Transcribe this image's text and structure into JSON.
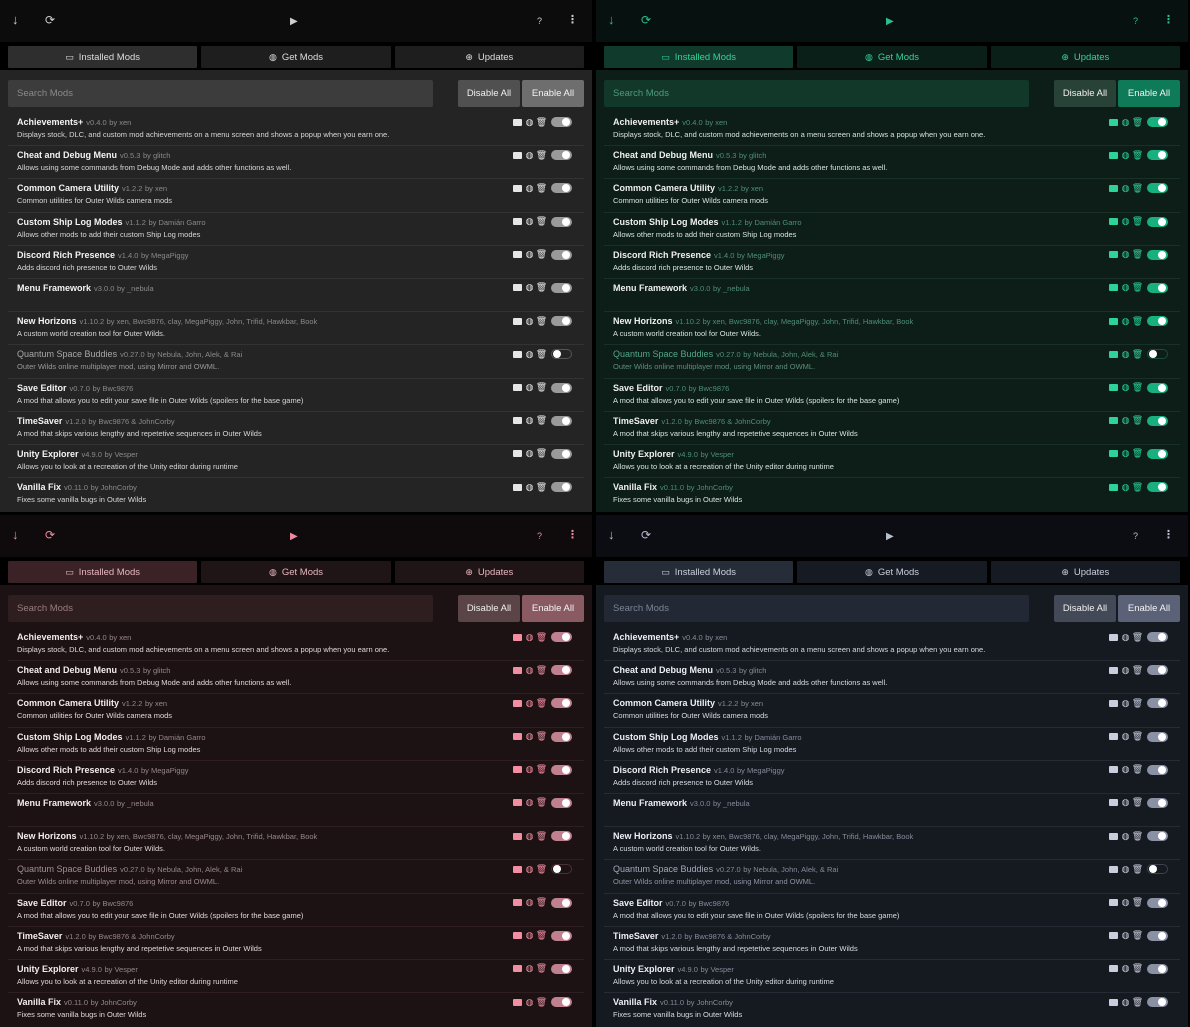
{
  "topbar": {
    "download_icon": "↓",
    "refresh_icon": "⟳",
    "play_icon": "▶",
    "help_icon": "?",
    "more_icon": "⋮"
  },
  "tabs": [
    {
      "label": "Installed Mods",
      "icon": "monitor-icon"
    },
    {
      "label": "Get Mods",
      "icon": "globe-icon"
    },
    {
      "label": "Updates",
      "icon": "arrow-up-circle-icon"
    }
  ],
  "search": {
    "placeholder": "Search Mods"
  },
  "buttons": {
    "disable_all": "Disable All",
    "enable_all": "Enable All"
  },
  "themes": [
    {
      "name": "grey",
      "accent": "#9a9a9a"
    },
    {
      "name": "green",
      "accent": "#17b07e"
    },
    {
      "name": "pink",
      "accent": "#c0808e"
    },
    {
      "name": "slate",
      "accent": "#8a91a5"
    }
  ],
  "mods": [
    {
      "name": "Achievements+",
      "version": "v0.4.0",
      "authors": "by xen",
      "description": "Displays stock, DLC, and custom mod achievements on a menu screen and shows a popup when you earn one.",
      "enabled": true
    },
    {
      "name": "Cheat and Debug Menu",
      "version": "v0.5.3",
      "authors": "by glitch",
      "description": "Allows using some commands from Debug Mode and adds other functions as well.",
      "enabled": true
    },
    {
      "name": "Common Camera Utility",
      "version": "v1.2.2",
      "authors": "by xen",
      "description": "Common utilities for Outer Wilds camera mods",
      "enabled": true
    },
    {
      "name": "Custom Ship Log Modes",
      "version": "v1.1.2",
      "authors": "by Damián Garro",
      "description": "Allows other mods to add their custom Ship Log modes",
      "enabled": true
    },
    {
      "name": "Discord Rich Presence",
      "version": "v1.4.0",
      "authors": "by MegaPiggy",
      "description": "Adds discord rich presence to Outer Wilds",
      "enabled": true
    },
    {
      "name": "Menu Framework",
      "version": "v3.0.0",
      "authors": "by _nebula",
      "description": "",
      "enabled": true
    },
    {
      "name": "New Horizons",
      "version": "v1.10.2",
      "authors": "by xen, Bwc9876, clay, MegaPiggy, John, Trifid, Hawkbar, Book",
      "description": "A custom world creation tool for Outer Wilds.",
      "enabled": true
    },
    {
      "name": "Quantum Space Buddies",
      "version": "v0.27.0",
      "authors": "by Nebula, John, Alek, & Rai",
      "description": "Outer Wilds online multiplayer mod, using Mirror and OWML.",
      "enabled": false
    },
    {
      "name": "Save Editor",
      "version": "v0.7.0",
      "authors": "by Bwc9876",
      "description": "A mod that allows you to edit your save file in Outer Wilds (spoilers for the base game)",
      "enabled": true
    },
    {
      "name": "TimeSaver",
      "version": "v1.2.0",
      "authors": "by Bwc9876 & JohnCorby",
      "description": "A mod that skips various lengthy and repetetive sequences in Outer Wilds",
      "enabled": true
    },
    {
      "name": "Unity Explorer",
      "version": "v4.9.0",
      "authors": "by Vesper",
      "description": "Allows you to look at a recreation of the Unity editor during runtime",
      "enabled": true
    },
    {
      "name": "Vanilla Fix",
      "version": "v0.11.0",
      "authors": "by JohnCorby",
      "description": "Fixes some vanilla bugs in Outer Wilds",
      "enabled": true
    }
  ]
}
